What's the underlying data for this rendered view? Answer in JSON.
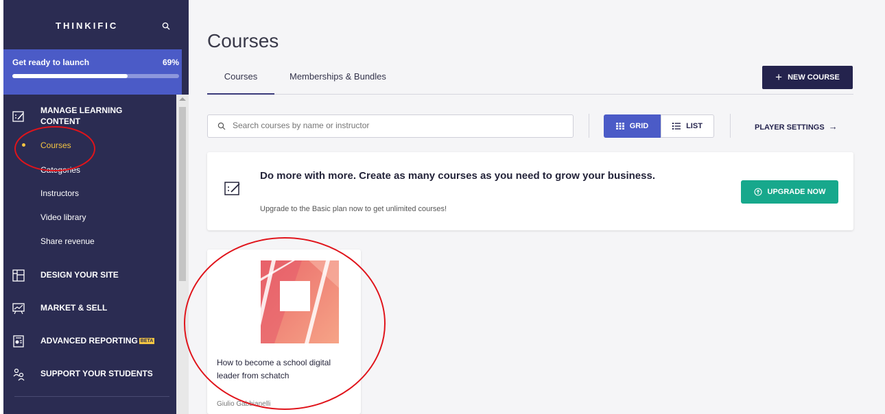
{
  "sidebar": {
    "brand": "THINKIFIC",
    "launch": {
      "label": "Get ready to launch",
      "percent_label": "69%",
      "progress": 0.69
    },
    "sections": [
      {
        "label_line1": "MANAGE LEARNING",
        "label_line2": "CONTENT",
        "icon": "edit-icon"
      },
      {
        "label": "DESIGN YOUR SITE",
        "icon": "layout-icon"
      },
      {
        "label": "MARKET & SELL",
        "icon": "presentation-chart-icon"
      },
      {
        "label": "ADVANCED REPORTING",
        "badge": "BETA",
        "icon": "report-icon"
      },
      {
        "label": "SUPPORT YOUR STUDENTS",
        "icon": "users-icon"
      }
    ],
    "subitems": [
      "Courses",
      "Categories",
      "Instructors",
      "Video library",
      "Share revenue"
    ]
  },
  "main": {
    "title": "Courses",
    "tabs": [
      "Courses",
      "Memberships & Bundles"
    ],
    "new_course_label": "NEW COURSE",
    "search_placeholder": "Search courses by name or instructor",
    "grid_label": "GRID",
    "list_label": "LIST",
    "player_settings_label": "PLAYER SETTINGS",
    "upgrade": {
      "title": "Do more with more. Create as many courses as you need to grow your business.",
      "subtitle": "Upgrade to the Basic plan now to get unlimited courses!",
      "button_label": "UPGRADE NOW"
    },
    "course": {
      "title": "How to become a school digital leader from schatch",
      "author": "Giulio Gabbianelli"
    }
  },
  "colors": {
    "sidebar_bg": "#2b2c52",
    "launch_bg": "#4b5bc7",
    "active_accent": "#f4c542",
    "primary_dark": "#24234d",
    "upgrade_green": "#17a88c",
    "annotation_red": "#e0141b"
  }
}
